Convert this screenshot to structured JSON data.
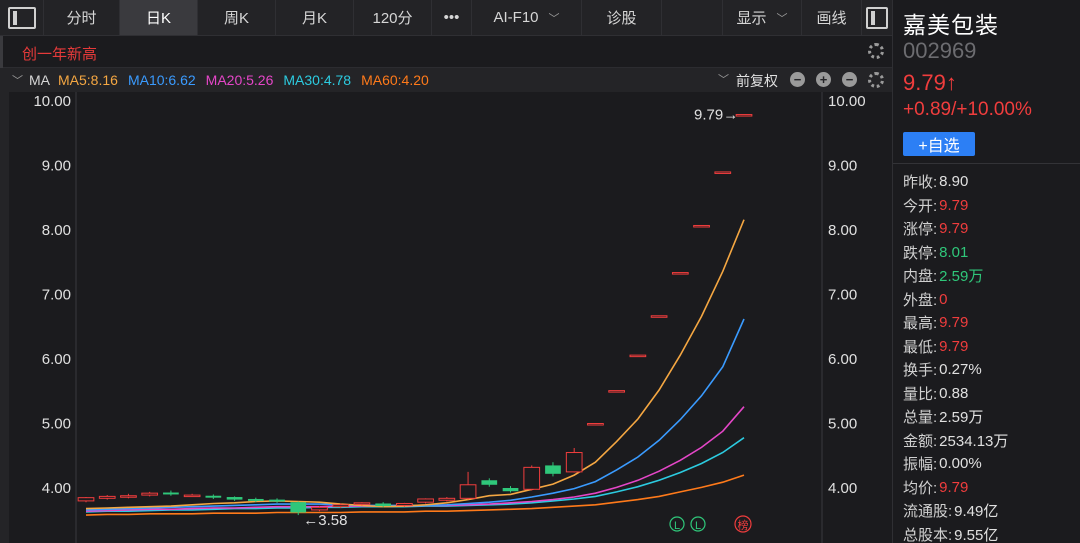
{
  "toolbar": {
    "tabs": [
      "分时",
      "日K",
      "周K",
      "月K",
      "120分",
      "•••",
      "AI-F10",
      "诊股"
    ],
    "active_tab": "日K",
    "ai_chevron": "﹀",
    "display_label": "显示",
    "display_chevron": "﹀",
    "draw_label": "画线"
  },
  "subrow": {
    "new_high_label": "创一年新高"
  },
  "ma_row": {
    "collapse": "﹀",
    "title": "MA",
    "items": [
      {
        "label": "MA5:8.16",
        "color": "#f5a742"
      },
      {
        "label": "MA10:6.62",
        "color": "#3a9bff"
      },
      {
        "label": "MA20:5.26",
        "color": "#e546c8"
      },
      {
        "label": "MA30:4.78",
        "color": "#2ccbe0"
      },
      {
        "label": "MA60:4.20",
        "color": "#ff7a1a"
      }
    ],
    "adjust_label": "前复权",
    "adjust_chevron": "﹀",
    "minus": "−",
    "plus": "+"
  },
  "chart": {
    "y_ticks": [
      "10.00",
      "9.00",
      "8.00",
      "7.00",
      "6.00",
      "5.00",
      "4.00"
    ],
    "max_label": "9.79→",
    "min_label": "←3.58",
    "badges": [
      "L",
      "L",
      "榜"
    ],
    "colors": {
      "up": "#f03d3d",
      "down": "#2fc77a",
      "grid": "#2a2a2e"
    }
  },
  "chart_data": {
    "type": "candlestick",
    "ylim": [
      3.5,
      10.2
    ],
    "y_ticks": [
      10.0,
      9.0,
      8.0,
      7.0,
      6.0,
      5.0,
      4.0
    ],
    "candles": [
      {
        "o": 3.8,
        "c": 3.85,
        "h": 3.86,
        "l": 3.78
      },
      {
        "o": 3.84,
        "c": 3.87,
        "h": 3.89,
        "l": 3.82
      },
      {
        "o": 3.86,
        "c": 3.88,
        "h": 3.91,
        "l": 3.84
      },
      {
        "o": 3.89,
        "c": 3.92,
        "h": 3.94,
        "l": 3.87
      },
      {
        "o": 3.93,
        "c": 3.9,
        "h": 3.96,
        "l": 3.88
      },
      {
        "o": 3.89,
        "c": 3.89,
        "h": 3.91,
        "l": 3.87
      },
      {
        "o": 3.88,
        "c": 3.85,
        "h": 3.9,
        "l": 3.83
      },
      {
        "o": 3.86,
        "c": 3.82,
        "h": 3.87,
        "l": 3.8
      },
      {
        "o": 3.83,
        "c": 3.8,
        "h": 3.85,
        "l": 3.78
      },
      {
        "o": 3.82,
        "c": 3.79,
        "h": 3.84,
        "l": 3.77
      },
      {
        "o": 3.78,
        "c": 3.62,
        "h": 3.79,
        "l": 3.58
      },
      {
        "o": 3.66,
        "c": 3.7,
        "h": 3.72,
        "l": 3.64
      },
      {
        "o": 3.71,
        "c": 3.74,
        "h": 3.76,
        "l": 3.69
      },
      {
        "o": 3.75,
        "c": 3.77,
        "h": 3.78,
        "l": 3.73
      },
      {
        "o": 3.76,
        "c": 3.72,
        "h": 3.78,
        "l": 3.7
      },
      {
        "o": 3.73,
        "c": 3.76,
        "h": 3.77,
        "l": 3.71
      },
      {
        "o": 3.78,
        "c": 3.83,
        "h": 3.84,
        "l": 3.76
      },
      {
        "o": 3.81,
        "c": 3.84,
        "h": 3.86,
        "l": 3.79
      },
      {
        "o": 3.84,
        "c": 4.05,
        "h": 4.25,
        "l": 3.82
      },
      {
        "o": 4.12,
        "c": 4.05,
        "h": 4.15,
        "l": 4.02
      },
      {
        "o": 4.0,
        "c": 3.95,
        "h": 4.03,
        "l": 3.93
      },
      {
        "o": 3.98,
        "c": 4.32,
        "h": 4.35,
        "l": 3.96
      },
      {
        "o": 4.35,
        "c": 4.22,
        "h": 4.4,
        "l": 4.18
      },
      {
        "o": 4.25,
        "c": 4.55,
        "h": 4.62,
        "l": 4.24
      },
      {
        "o": 5.0,
        "c": 5.0,
        "h": 5.0,
        "l": 5.0
      },
      {
        "o": 5.51,
        "c": 5.51,
        "h": 5.51,
        "l": 5.51
      },
      {
        "o": 6.06,
        "c": 6.06,
        "h": 6.06,
        "l": 6.06
      },
      {
        "o": 6.67,
        "c": 6.67,
        "h": 6.67,
        "l": 6.67
      },
      {
        "o": 7.34,
        "c": 7.34,
        "h": 7.34,
        "l": 7.34
      },
      {
        "o": 8.07,
        "c": 8.07,
        "h": 8.07,
        "l": 8.07
      },
      {
        "o": 8.9,
        "c": 8.9,
        "h": 8.9,
        "l": 8.9
      },
      {
        "o": 9.79,
        "c": 9.79,
        "h": 9.79,
        "l": 9.79
      }
    ],
    "ma_series": [
      {
        "name": "MA5",
        "color": "#f5a742",
        "values": [
          3.68,
          3.69,
          3.7,
          3.71,
          3.72,
          3.74,
          3.76,
          3.77,
          3.79,
          3.8,
          3.79,
          3.78,
          3.75,
          3.73,
          3.71,
          3.72,
          3.74,
          3.77,
          3.82,
          3.88,
          3.9,
          3.98,
          4.06,
          4.2,
          4.4,
          4.72,
          5.07,
          5.52,
          6.06,
          6.66,
          7.36,
          8.16
        ]
      },
      {
        "name": "MA10",
        "color": "#3a9bff",
        "values": [
          3.66,
          3.67,
          3.68,
          3.69,
          3.7,
          3.71,
          3.72,
          3.73,
          3.74,
          3.75,
          3.75,
          3.75,
          3.74,
          3.73,
          3.73,
          3.73,
          3.73,
          3.74,
          3.76,
          3.78,
          3.81,
          3.86,
          3.92,
          3.99,
          4.1,
          4.28,
          4.48,
          4.74,
          5.06,
          5.43,
          5.88,
          6.62
        ]
      },
      {
        "name": "MA20",
        "color": "#e546c8",
        "values": [
          3.64,
          3.65,
          3.66,
          3.67,
          3.67,
          3.68,
          3.69,
          3.69,
          3.7,
          3.71,
          3.71,
          3.71,
          3.72,
          3.72,
          3.72,
          3.72,
          3.73,
          3.73,
          3.74,
          3.75,
          3.77,
          3.79,
          3.82,
          3.86,
          3.92,
          4.01,
          4.12,
          4.26,
          4.43,
          4.63,
          4.88,
          5.26
        ]
      },
      {
        "name": "MA30",
        "color": "#2ccbe0",
        "values": [
          3.63,
          3.64,
          3.64,
          3.65,
          3.66,
          3.66,
          3.67,
          3.68,
          3.68,
          3.69,
          3.69,
          3.7,
          3.7,
          3.71,
          3.71,
          3.71,
          3.72,
          3.72,
          3.73,
          3.74,
          3.75,
          3.77,
          3.8,
          3.83,
          3.87,
          3.94,
          4.02,
          4.12,
          4.24,
          4.38,
          4.55,
          4.78
        ]
      },
      {
        "name": "MA60",
        "color": "#ff7a1a",
        "values": [
          3.58,
          3.59,
          3.59,
          3.6,
          3.6,
          3.6,
          3.61,
          3.61,
          3.61,
          3.62,
          3.62,
          3.62,
          3.62,
          3.63,
          3.63,
          3.63,
          3.64,
          3.64,
          3.65,
          3.66,
          3.67,
          3.68,
          3.7,
          3.72,
          3.74,
          3.78,
          3.82,
          3.87,
          3.94,
          4.01,
          4.09,
          4.2
        ]
      }
    ],
    "max_marker": 9.79,
    "min_marker": 3.58
  },
  "stock": {
    "name": "嘉美包装",
    "code": "002969",
    "price": "9.79↑",
    "change": "+0.89/+10.00%",
    "watch_label": "+自选"
  },
  "stats": [
    {
      "label": "昨收:",
      "value": "8.90",
      "color": "#e0e0e0"
    },
    {
      "label": "今开:",
      "value": "9.79",
      "color": "#f03d3d"
    },
    {
      "label": "涨停:",
      "value": "9.79",
      "color": "#f03d3d"
    },
    {
      "label": "跌停:",
      "value": "8.01",
      "color": "#2fc77a"
    },
    {
      "label": "内盘:",
      "value": "2.59万",
      "color": "#2fc77a"
    },
    {
      "label": "外盘:",
      "value": "0",
      "color": "#f03d3d"
    },
    {
      "label": "最高:",
      "value": "9.79",
      "color": "#f03d3d"
    },
    {
      "label": "最低:",
      "value": "9.79",
      "color": "#f03d3d"
    },
    {
      "label": "换手:",
      "value": "0.27%",
      "color": "#e0e0e0"
    },
    {
      "label": "量比:",
      "value": "0.88",
      "color": "#e0e0e0"
    },
    {
      "label": "总量:",
      "value": "2.59万",
      "color": "#e0e0e0"
    },
    {
      "label": "金额:",
      "value": "2534.13万",
      "color": "#e0e0e0"
    },
    {
      "label": "振幅:",
      "value": "0.00%",
      "color": "#e0e0e0"
    },
    {
      "label": "均价:",
      "value": "9.79",
      "color": "#f03d3d"
    },
    {
      "label": "流通股:",
      "value": "9.49亿",
      "color": "#e0e0e0"
    },
    {
      "label": "总股本:",
      "value": "9.55亿",
      "color": "#e0e0e0"
    }
  ]
}
